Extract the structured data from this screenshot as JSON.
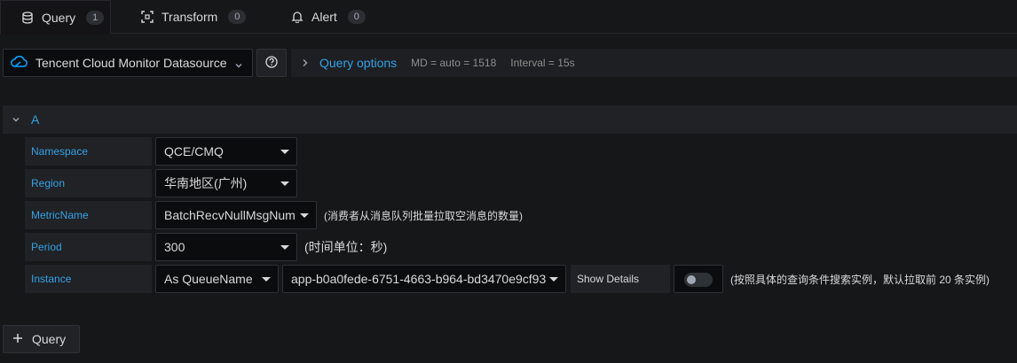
{
  "tabs": [
    {
      "label": "Query",
      "count": "1",
      "icon": "database-icon"
    },
    {
      "label": "Transform",
      "count": "0",
      "icon": "transform-icon"
    },
    {
      "label": "Alert",
      "count": "0",
      "icon": "bell-icon"
    }
  ],
  "datasource": {
    "name": "Tencent Cloud Monitor Datasource",
    "icon": "cloud-icon"
  },
  "query_options": {
    "title": "Query options",
    "md": "MD = auto = 1518",
    "interval": "Interval = 15s"
  },
  "query": {
    "ref_id": "A",
    "namespace": {
      "label": "Namespace",
      "value": "QCE/CMQ"
    },
    "region": {
      "label": "Region",
      "value": "华南地区(广州)"
    },
    "metric": {
      "label": "MetricName",
      "value": "BatchRecvNullMsgNum",
      "hint": "(消费者从消息队列批量拉取空消息的数量)"
    },
    "period": {
      "label": "Period",
      "value": "300",
      "hint": "(时间单位：秒)"
    },
    "instance": {
      "label": "Instance",
      "as_value": "As QueueName",
      "value": "app-b0a0fede-6751-4663-b964-bd3470e9cf93",
      "show_details_label": "Show Details",
      "show_details_on": false,
      "hint": "(按照具体的查询条件搜索实例，默认拉取前 20 条实例)"
    }
  },
  "add_query_label": "Query",
  "colors": {
    "accent": "#33a2e5",
    "background": "#161719",
    "panel": "#202226",
    "input": "#0b0c0e"
  }
}
